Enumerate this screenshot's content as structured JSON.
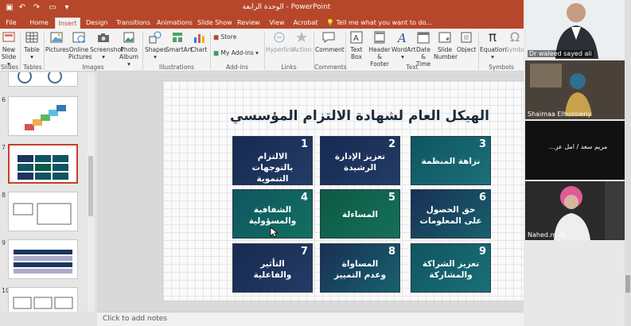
{
  "app": {
    "window_title": "الوحدة الرابعة - PowerPoint",
    "tell_me": "Tell me what you want to do...",
    "tabs": [
      "File",
      "Home",
      "Insert",
      "Design",
      "Transitions",
      "Animations",
      "Slide Show",
      "Review",
      "View",
      "Acrobat"
    ],
    "active_tab": "Insert",
    "accent": "#b7472a"
  },
  "ribbon": {
    "new_slide": [
      "New",
      "Slide"
    ],
    "table": "Table",
    "pictures": "Pictures",
    "online_pictures": [
      "Online",
      "Pictures"
    ],
    "screenshot": "Screenshot",
    "photo_album": [
      "Photo",
      "Album"
    ],
    "shapes": "Shapes",
    "smartart": "SmartArt",
    "chart": "Chart",
    "store": "Store",
    "my_addins": "My Add-ins",
    "hyperlink": "Hyperlink",
    "action": "Action",
    "comment": "Comment",
    "text_box": [
      "Text",
      "Box"
    ],
    "header_footer": [
      "Header",
      "& Footer"
    ],
    "wordart": "WordArt",
    "date_time": [
      "Date &",
      "Time"
    ],
    "slide_number": [
      "Slide",
      "Number"
    ],
    "object": "Object",
    "equation": "Equation",
    "symbol": "Symbol",
    "groups": {
      "slides": "Slides",
      "tables": "Tables",
      "images": "Images",
      "illustrations": "Illustrations",
      "addins": "Add-ins",
      "links": "Links",
      "comments": "Comments",
      "text": "Text",
      "symbols": "Symbols"
    }
  },
  "thumbnails": {
    "numbers": [
      "6",
      "7",
      "8",
      "9",
      "10"
    ],
    "selected": "7"
  },
  "slide": {
    "title": "الهيكل العام لشهادة الالتزام المؤسسي",
    "cards": [
      {
        "num": "1",
        "line1": "الالتزام بالتوجهات",
        "line2": "التنموية"
      },
      {
        "num": "2",
        "line1": "تعزيز الإدارة",
        "line2": "الرشيدة"
      },
      {
        "num": "3",
        "line1": "نزاهة المنظمة",
        "line2": ""
      },
      {
        "num": "4",
        "line1": "الشفافية",
        "line2": "والمسؤولية"
      },
      {
        "num": "5",
        "line1": "المساءلة",
        "line2": ""
      },
      {
        "num": "6",
        "line1": "حق الحصول",
        "line2": "على المعلومات"
      },
      {
        "num": "7",
        "line1": "التأثير",
        "line2": "والفاعلية"
      },
      {
        "num": "8",
        "line1": "المساواة",
        "line2": "وعدم التمييز"
      },
      {
        "num": "9",
        "line1": "تعزيز الشراكة",
        "line2": "والمشاركة"
      }
    ]
  },
  "notes_placeholder": "Click to add notes",
  "participants": [
    {
      "name": "Dr waleed sayed ali"
    },
    {
      "name": "Shaimaa Elhussieny"
    },
    {
      "name": "...مريم سعد / امل عز"
    },
    {
      "name": "Nahed.m Ali"
    }
  ]
}
